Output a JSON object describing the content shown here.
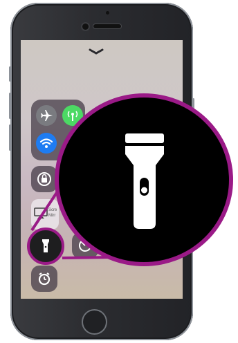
{
  "device": {
    "name": "iphone",
    "icons": [
      "home-button",
      "front-camera",
      "earpiece-speaker"
    ]
  },
  "control_center": {
    "pull_indicator": "chevron-down-icon",
    "connectivity": [
      {
        "name": "airplane-mode",
        "icon": "airplane-icon",
        "color": "#7a7b80"
      },
      {
        "name": "cellular-data",
        "icon": "antenna-icon",
        "color": "#4cd964"
      },
      {
        "name": "wifi",
        "icon": "wifi-icon",
        "color": "#1e7cf2"
      }
    ],
    "screen_mirroring_partial": "Scre Mirr",
    "tiles": [
      {
        "name": "orientation-lock",
        "icon": "lock-rotation-icon"
      },
      {
        "name": "flashlight",
        "icon": "flashlight-icon",
        "highlighted": true
      },
      {
        "name": "timer",
        "icon": "timer-icon"
      },
      {
        "name": "clock",
        "icon": "alarm-clock-icon"
      }
    ]
  },
  "highlight": {
    "ring_color": "#9a1a87",
    "zoom_icon": "flashlight-icon"
  }
}
